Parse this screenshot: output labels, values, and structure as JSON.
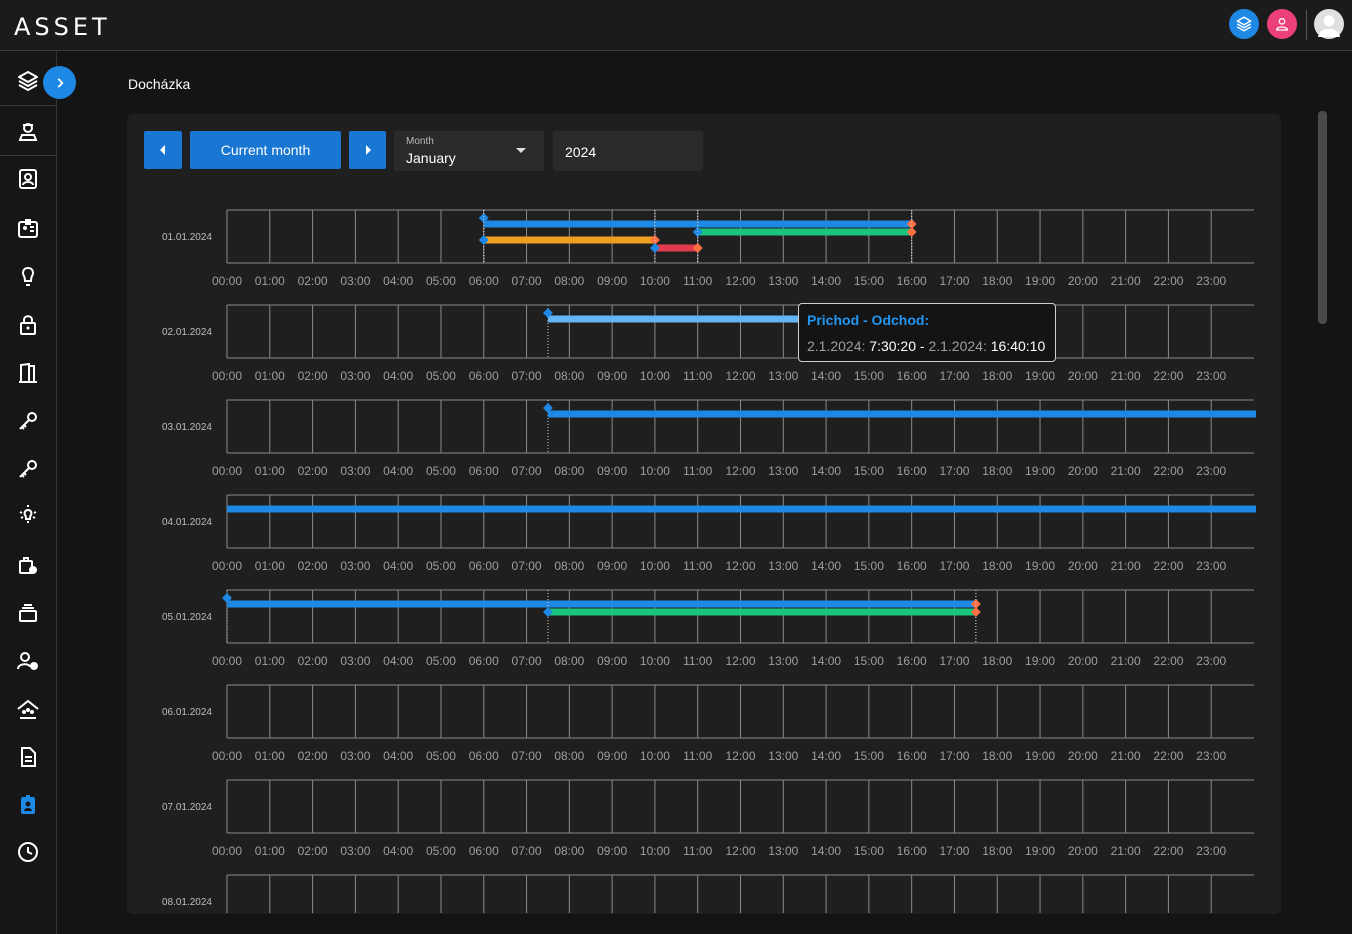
{
  "app": {
    "logo": "ASSET"
  },
  "page": {
    "title": "Docházka"
  },
  "topbar": {
    "icons": [
      "layers-icon",
      "user-badge-icon",
      "avatar"
    ]
  },
  "sidebar": {
    "items": [
      "layers-icon",
      "guard-icon",
      "contact-card-icon",
      "id-card-icon",
      "bulb-icon",
      "lock-icon",
      "door-icon",
      "key-icon",
      "key-icon",
      "light-icon",
      "case-clock-icon",
      "stack-icon",
      "user-clock-icon",
      "group-icon",
      "document-icon",
      "badge-icon",
      "clock-icon"
    ]
  },
  "toolbar": {
    "current_month_label": "Current month",
    "month_label": "Month",
    "month_value": "January",
    "year_value": "2024"
  },
  "tooltip": {
    "title": "Prichod - Odchod:",
    "from_date": "2.1.2024:",
    "from_time": "7:30:20",
    "separator": " - ",
    "to_date": "2.1.2024:",
    "to_time": "16:40:10"
  },
  "chart_data": {
    "type": "timeline",
    "x_ticks": [
      "00:00",
      "01:00",
      "02:00",
      "03:00",
      "04:00",
      "05:00",
      "06:00",
      "07:00",
      "08:00",
      "09:00",
      "10:00",
      "11:00",
      "12:00",
      "13:00",
      "14:00",
      "15:00",
      "16:00",
      "17:00",
      "18:00",
      "19:00",
      "20:00",
      "21:00",
      "22:00",
      "23:00"
    ],
    "xlim": [
      0,
      24
    ],
    "colors": {
      "blue": "#1e88e5",
      "lightblue": "#64b5f6",
      "orange": "#f0a020",
      "green": "#1bc47d",
      "red": "#e53950",
      "start_marker": "#1e88e5",
      "end_marker": "#ff7043"
    },
    "days": [
      {
        "date": "01.01.2024",
        "segments": [
          {
            "start": 6.0,
            "end": 16.0,
            "color": "blue",
            "row": 0
          },
          {
            "start": 11.0,
            "end": 16.0,
            "color": "green",
            "row": 1
          },
          {
            "start": 6.0,
            "end": 10.0,
            "color": "orange",
            "row": 2
          },
          {
            "start": 10.0,
            "end": 11.0,
            "color": "red",
            "row": 3
          }
        ]
      },
      {
        "date": "02.01.2024",
        "segments": [
          {
            "start": 7.5,
            "end": 16.67,
            "color": "lightblue",
            "row": 0
          }
        ]
      },
      {
        "date": "03.01.2024",
        "segments": [
          {
            "start": 7.5,
            "end": 24.0,
            "color": "blue",
            "row": 0,
            "open": true
          }
        ]
      },
      {
        "date": "04.01.2024",
        "segments": [
          {
            "start": 0.0,
            "end": 24.0,
            "color": "blue",
            "row": 0,
            "open": true,
            "no_marker": true
          }
        ]
      },
      {
        "date": "05.01.2024",
        "segments": [
          {
            "start": 0.0,
            "end": 17.5,
            "color": "blue",
            "row": 0
          },
          {
            "start": 7.5,
            "end": 17.5,
            "color": "green",
            "row": 1
          }
        ]
      },
      {
        "date": "06.01.2024",
        "segments": []
      },
      {
        "date": "07.01.2024",
        "segments": []
      },
      {
        "date": "08.01.2024",
        "segments": []
      }
    ]
  }
}
